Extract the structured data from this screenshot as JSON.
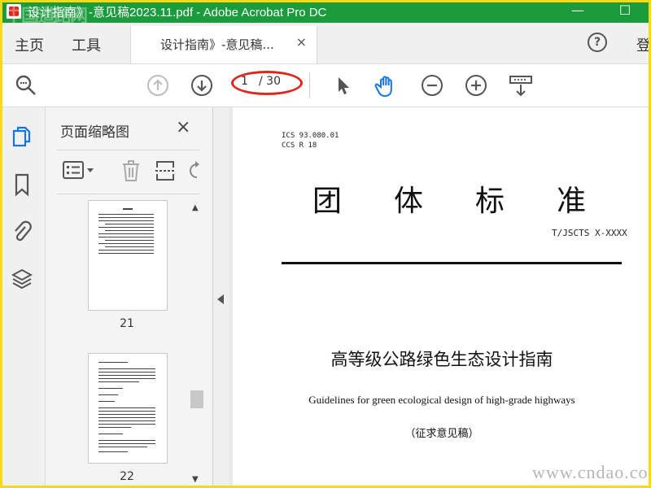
{
  "window": {
    "title": "设计指南》-意见稿2023.11.pdf - Adobe Acrobat Pro DC",
    "watermark_tl": "中国道路网",
    "minimize": "—",
    "maximize": "☐"
  },
  "menu": {
    "home": "主页",
    "tools": "工具",
    "tab_label": "设计指南》-意见稿...",
    "tab_close": "×",
    "help": "?",
    "login": "登"
  },
  "toolbar": {
    "current_page": "1",
    "total_pages": "/ 30"
  },
  "thumbnails": {
    "heading": "页面缩略图",
    "close": "×",
    "pages": [
      {
        "label": "21"
      },
      {
        "label": "22"
      }
    ]
  },
  "document": {
    "ics": "ICS 93.080.01",
    "ccs": "CCS R 18",
    "big_chars": [
      "团",
      "体",
      "标",
      "准"
    ],
    "std_no": "T/JSCTS X-XXXX",
    "cn_title": "高等级公路绿色生态设计指南",
    "en_title": "Guidelines for green ecological design of high-grade highways",
    "draft": "（征求意见稿）"
  },
  "watermark_br": "www.cndao.com",
  "colors": {
    "titlebar": "#1a9b3c",
    "accent_blue": "#1473e6",
    "highlight_red": "#e0261b",
    "frame_yellow": "#f7d918"
  }
}
